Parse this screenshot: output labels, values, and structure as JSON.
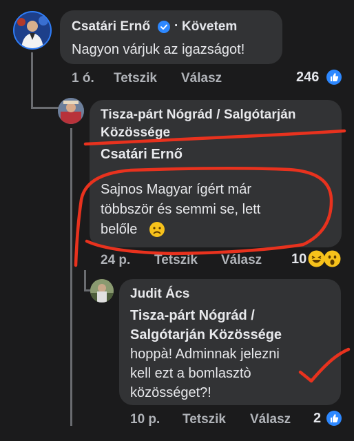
{
  "comments": [
    {
      "author": "Csatári Ernő",
      "follow_label": "Követem",
      "text": "Nagyon várjuk az igazságot!",
      "time": "1 ó.",
      "like_label": "Tetszik",
      "reply_label": "Válasz",
      "reaction_count": "246"
    },
    {
      "author_line1": "Tisza-párt Nógrád / Salgótarján",
      "author_line2": "Közössége",
      "mention": "Csatári Ernő",
      "text_line1": "Sajnos Magyar ígért már",
      "text_line2": "többször és semmi se, lett",
      "text_line3": "belőle",
      "time": "24 p.",
      "like_label": "Tetszik",
      "reply_label": "Válasz",
      "reaction_count": "10"
    },
    {
      "author": "Judit Ács",
      "mention_line1": "Tisza-párt Nógrád /",
      "mention_line2": "Salgótarján Közössége",
      "text_line1": "hoppà! Adminnak jelezni",
      "text_line2": "kell ezt a bomlasztò",
      "text_line3": "közösséget?!",
      "time": "10 p.",
      "like_label": "Tetszik",
      "reply_label": "Válasz",
      "reaction_count": "2"
    }
  ],
  "icons": {
    "verified": "verified-badge-icon",
    "like": "like-thumb-icon",
    "sad_emoji": "sad-face-emoji",
    "laugh_emoji": "laughing-emoji",
    "wow_emoji": "wow-emoji"
  },
  "colors": {
    "background": "#1b1b1c",
    "bubble": "#323335",
    "accent": "#2d88ff",
    "annotation": "#e8321e"
  }
}
